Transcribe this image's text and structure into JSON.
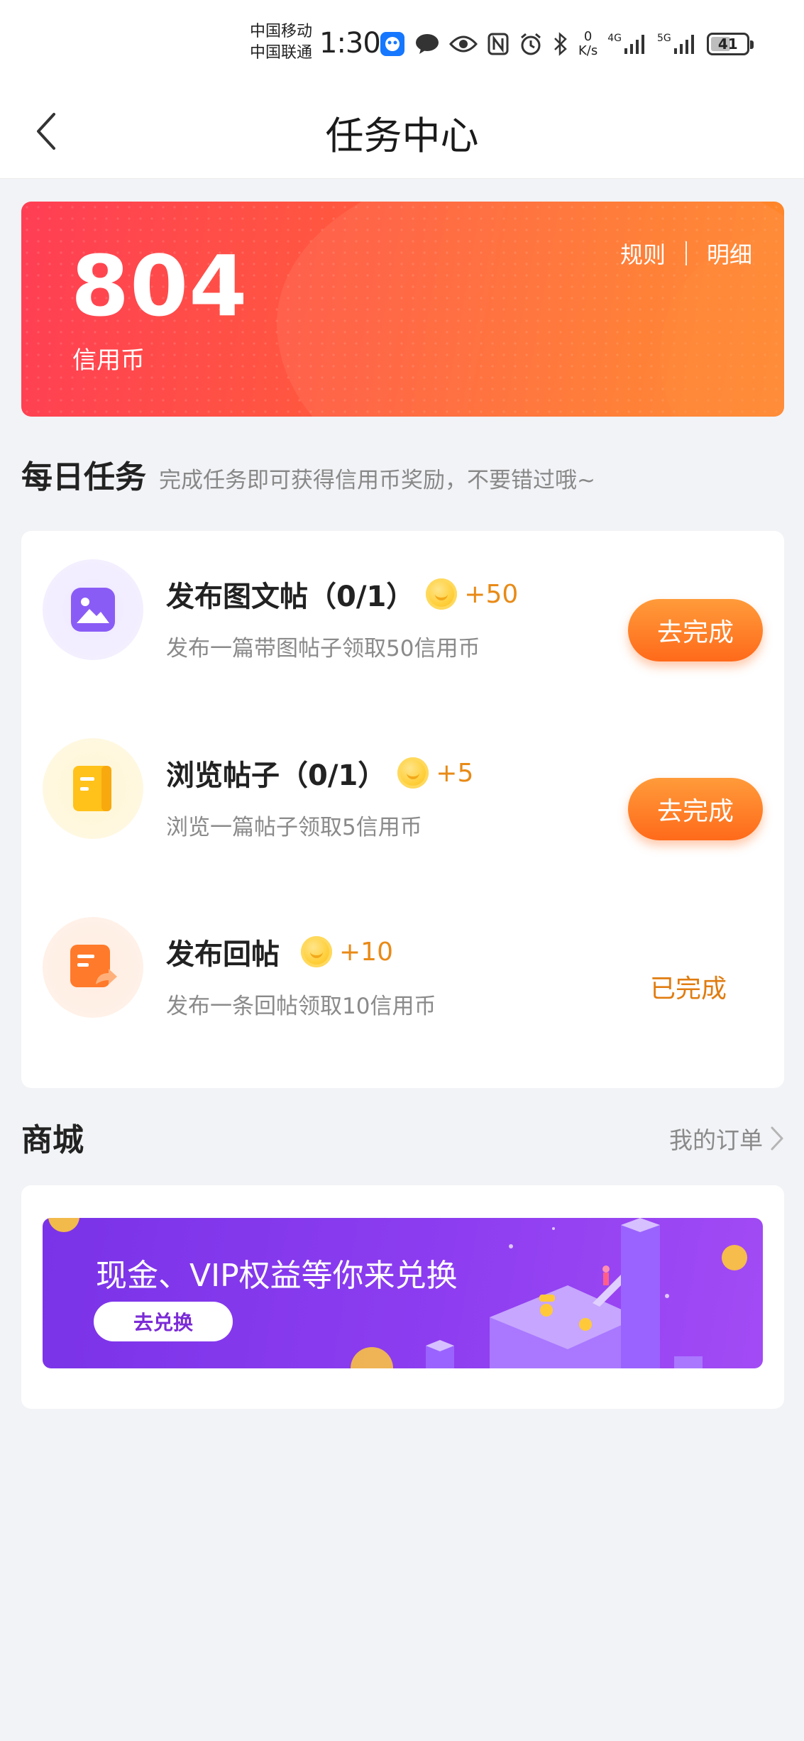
{
  "status_bar": {
    "carrier_1": "中国移动",
    "carrier_2": "中国联通",
    "time": "1:30",
    "net_speed_value": "0",
    "net_speed_unit": "K/s",
    "network_1": "4G",
    "network_2": "5G",
    "battery": "41"
  },
  "nav": {
    "title": "任务中心"
  },
  "points": {
    "value": "804",
    "unit": "信用币",
    "rules_label": "规则",
    "detail_label": "明细"
  },
  "daily": {
    "title": "每日任务",
    "subtitle": "完成任务即可获得信用币奖励，不要错过哦~"
  },
  "tasks": [
    {
      "title": "发布图文帖（0/1）",
      "reward": "+50",
      "desc": "发布一篇带图帖子领取50信用币",
      "action": "去完成",
      "icon": "image-icon"
    },
    {
      "title": "浏览帖子（0/1）",
      "reward": "+5",
      "desc": "浏览一篇帖子领取5信用币",
      "action": "去完成",
      "icon": "document-icon"
    },
    {
      "title": "发布回帖",
      "reward": "+10",
      "desc": "发布一条回帖领取10信用币",
      "action": "已完成",
      "icon": "reply-post-icon"
    }
  ],
  "store": {
    "title": "商城",
    "orders_label": "我的订单",
    "banner_text": "现金、VIP权益等你来兑换",
    "banner_button": "去兑换"
  },
  "colors": {
    "accent_orange": "#ff6a1a",
    "card_red": "#ff3e55",
    "banner_purple": "#8d3df0",
    "done_text": "#e07c10"
  }
}
